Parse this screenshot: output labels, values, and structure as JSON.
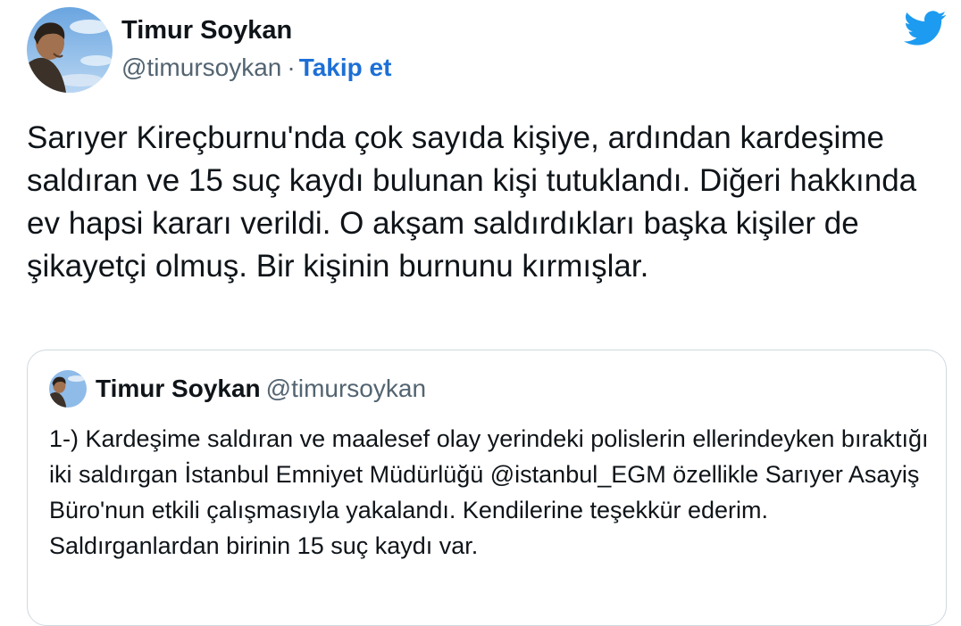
{
  "author": {
    "name": "Timur Soykan",
    "handle": "@timursoykan",
    "separator": "·",
    "follow_label": "Takip et"
  },
  "brand": {
    "icon": "twitter-bird-icon",
    "color": "#1d9bf0"
  },
  "tweet": {
    "text": "Sarıyer Kireçburnu'nda çok sayıda kişiye, ardından kardeşime saldıran ve 15 suç kaydı bulunan kişi tutuklandı. Diğeri hakkında ev hapsi kararı verildi. O akşam saldırdıkları başka kişiler de şikayetçi olmuş. Bir kişinin burnunu kırmışlar."
  },
  "quoted_tweet": {
    "name": "Timur Soykan",
    "handle": "@timursoykan",
    "text": "1-) Kardeşime saldıran ve maalesef olay yerindeki polislerin ellerindeyken bıraktığı iki saldırgan İstanbul Emniyet Müdürlüğü @istanbul_EGM özellikle Sarıyer Asayiş Büro'nun etkili çalışmasıyla yakalandı. Kendilerine teşekkür ederim. Saldırganlardan birinin 15 suç kaydı var."
  },
  "colors": {
    "link": "#1d6fd6",
    "secondary_text": "#536471",
    "border": "#cfd9de"
  }
}
